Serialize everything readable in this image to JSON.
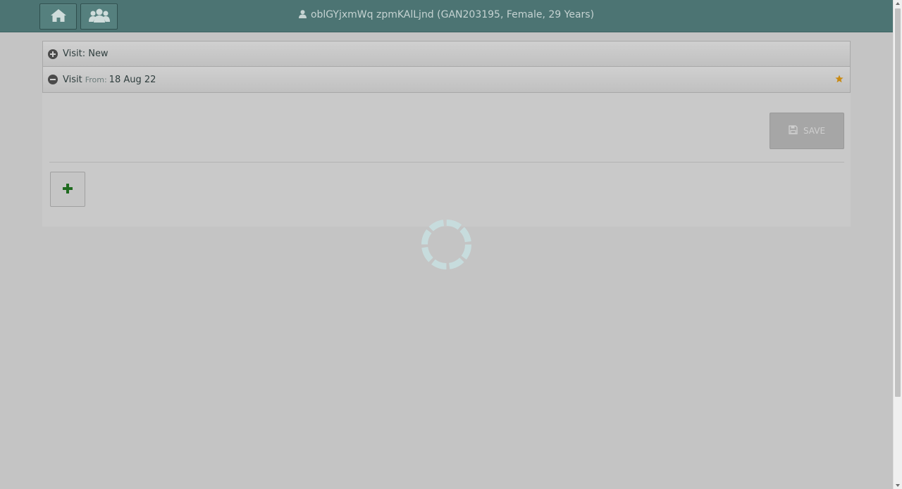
{
  "header": {
    "home_icon": "home-icon",
    "people_icon": "users-icon",
    "patient_icon": "user-icon",
    "patient_label": "oblGYjxmWq zpmKAlLjnd (GAN203195, Female, 29 Years)"
  },
  "visits": {
    "new_label": "Visit: New",
    "current_label": "Visit",
    "from_label": "From:",
    "from_date": "18 Aug 22",
    "star_icon": "star-icon"
  },
  "actions": {
    "save_label": "SAVE",
    "save_icon": "floppy-disk-icon",
    "add_icon": "plus-icon"
  },
  "colors": {
    "header_bg": "#4c7473",
    "star": "#c98a12",
    "add": "#1f6b1f"
  }
}
